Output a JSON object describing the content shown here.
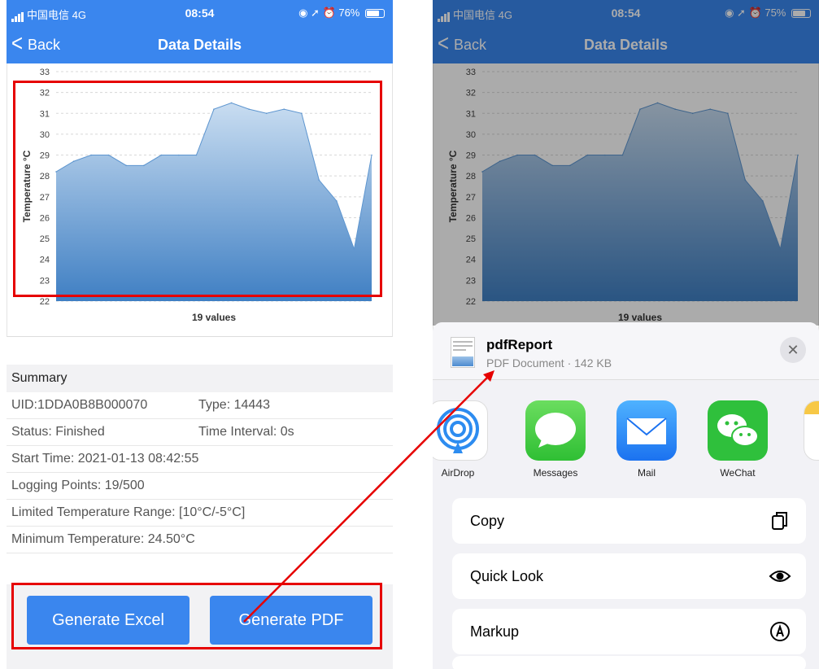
{
  "left_phone": {
    "status": {
      "carrier": "中国电信",
      "network": "4G",
      "time": "08:54",
      "battery": "76%"
    },
    "nav": {
      "back_label": "Back",
      "title": "Data Details"
    },
    "summary": {
      "heading": "Summary",
      "rows": [
        {
          "col1": "UID:1DDA0B8B000070",
          "col2": "Type: 14443"
        },
        {
          "col1": "Status: Finished",
          "col2": "Time Interval: 0s"
        },
        {
          "col1": "Start Time: 2021-01-13 08:42:55"
        },
        {
          "col1": "Logging Points: 19/500"
        },
        {
          "col1": "Limited Temperature Range: [10°C/-5°C]"
        },
        {
          "col1": "Minimum Temperature: 24.50°C"
        }
      ]
    },
    "buttons": {
      "excel": "Generate Excel",
      "pdf": "Generate PDF"
    }
  },
  "right_phone": {
    "status": {
      "carrier": "中国电信",
      "network": "4G",
      "time": "08:54",
      "battery": "75%"
    },
    "nav": {
      "back_label": "Back",
      "title": "Data Details"
    },
    "share_sheet": {
      "file_name": "pdfReport",
      "file_info": "PDF Document · 142 KB",
      "apps": [
        {
          "label": "AirDrop",
          "icon": "airdrop-icon"
        },
        {
          "label": "Messages",
          "icon": "messages-icon"
        },
        {
          "label": "Mail",
          "icon": "mail-icon"
        },
        {
          "label": "WeChat",
          "icon": "wechat-icon"
        }
      ],
      "actions": [
        {
          "label": "Copy",
          "icon": "copy-icon"
        },
        {
          "label": "Quick Look",
          "icon": "eye-icon"
        },
        {
          "label": "Markup",
          "icon": "markup-icon"
        }
      ]
    }
  },
  "colors": {
    "accent": "#3a86ee",
    "highlight": "#e60000",
    "area_top": "#c9ddf1",
    "area_bottom": "#3f7fc3"
  },
  "chart_data": {
    "type": "area",
    "xlabel": "19 values",
    "ylabel": "Temperature °C",
    "ylim": [
      22,
      33
    ],
    "yticks": [
      22,
      23,
      24,
      25,
      26,
      27,
      28,
      29,
      30,
      31,
      32,
      33
    ],
    "grid": true,
    "series": [
      {
        "values": [
          28.2,
          28.7,
          29.0,
          29.0,
          28.5,
          28.5,
          29.0,
          29.0,
          29.0,
          31.2,
          31.5,
          31.2,
          31.0,
          31.2,
          31.0,
          27.8,
          26.8,
          24.5,
          29.0
        ]
      }
    ]
  }
}
